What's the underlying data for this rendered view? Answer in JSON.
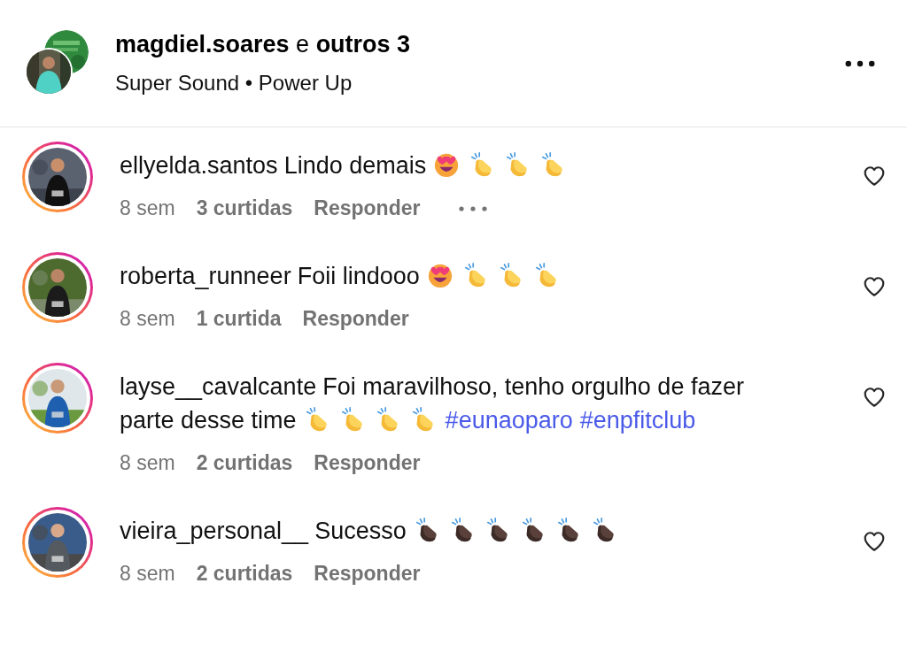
{
  "header": {
    "title": "**magdiel.soares** e **outros 3**",
    "subtitle": "Super Sound • Power Up"
  },
  "comments": [
    {
      "username": "ellyelda.santos",
      "lines": [
        [
          {
            "kind": "text",
            "text": "Lindo demais"
          },
          {
            "kind": "heart_eyes"
          },
          {
            "kind": "clap"
          },
          {
            "kind": "clap"
          },
          {
            "kind": "clap"
          }
        ]
      ],
      "time": "8 sem",
      "likes": "3 curtidas",
      "reply": "Responder",
      "show_more": true,
      "liked": false
    },
    {
      "username": "roberta_runneer",
      "lines": [
        [
          {
            "kind": "text",
            "text": "Foii lindooo"
          },
          {
            "kind": "heart_eyes"
          },
          {
            "kind": "clap"
          },
          {
            "kind": "clap"
          },
          {
            "kind": "clap"
          }
        ]
      ],
      "time": "8 sem",
      "likes": "1 curtida",
      "reply": "Responder",
      "show_more": false,
      "liked": false
    },
    {
      "username": "layse__cavalcante",
      "lines": [
        [
          {
            "kind": "text",
            "text": "Foi maravilhoso, tenho orgulho de fazer"
          }
        ],
        [
          {
            "kind": "text",
            "text": "parte desse time"
          },
          {
            "kind": "clap"
          },
          {
            "kind": "clap"
          },
          {
            "kind": "clap"
          },
          {
            "kind": "clap"
          },
          {
            "kind": "hashtag",
            "text": "#eunaoparo"
          },
          {
            "kind": "hashtag",
            "text": "#enpfitclub"
          }
        ]
      ],
      "time": "8 sem",
      "likes": "2 curtidas",
      "reply": "Responder",
      "show_more": false,
      "liked": false
    },
    {
      "username": "vieira_personal__",
      "lines": [
        [
          {
            "kind": "text",
            "text": "Sucesso"
          },
          {
            "kind": "clap_dark"
          },
          {
            "kind": "clap_dark"
          },
          {
            "kind": "clap_dark"
          },
          {
            "kind": "clap_dark"
          },
          {
            "kind": "clap_dark"
          },
          {
            "kind": "clap_dark"
          }
        ]
      ],
      "time": "8 sem",
      "likes": "2 curtidas",
      "reply": "Responder",
      "show_more": false,
      "liked": false
    }
  ]
}
